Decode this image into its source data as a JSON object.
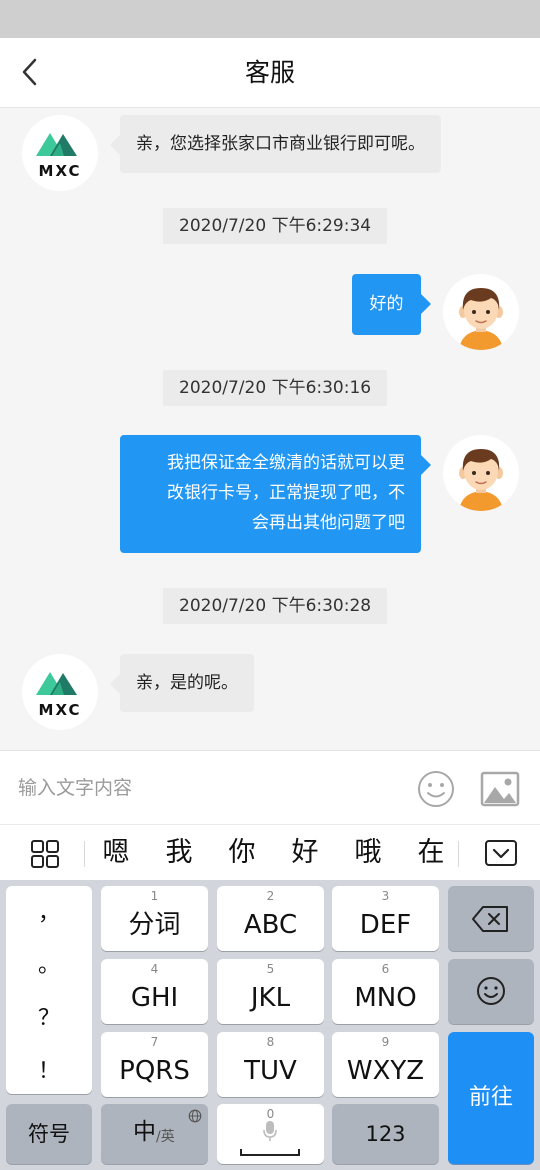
{
  "header": {
    "title": "客服"
  },
  "agent": {
    "logo_text": "MXC"
  },
  "messages": [
    {
      "side": "left",
      "text": "亲，您选择张家口市商业银行即可呢。"
    },
    {
      "timestamp": "2020/7/20 下午6:29:34"
    },
    {
      "side": "right",
      "text": "好的"
    },
    {
      "timestamp": "2020/7/20 下午6:30:16"
    },
    {
      "side": "right",
      "lines": [
        "我把保证金全缴清的话就可以更",
        "改银行卡号，正常提现了吧，不",
        "会再出其他问题了吧"
      ]
    },
    {
      "timestamp": "2020/7/20 下午6:30:28"
    },
    {
      "side": "left",
      "text": "亲，是的呢。"
    }
  ],
  "input": {
    "placeholder": "输入文字内容"
  },
  "candidates": [
    "嗯",
    "我",
    "你",
    "好",
    "哦",
    "在"
  ],
  "keyboard": {
    "punctuation": [
      "，",
      "。",
      "？",
      "！"
    ],
    "keys": [
      {
        "num": "1",
        "label": "分词"
      },
      {
        "num": "2",
        "label": "ABC"
      },
      {
        "num": "3",
        "label": "DEF"
      },
      {
        "num": "4",
        "label": "GHI"
      },
      {
        "num": "5",
        "label": "JKL"
      },
      {
        "num": "6",
        "label": "MNO"
      },
      {
        "num": "7",
        "label": "PQRS"
      },
      {
        "num": "8",
        "label": "TUV"
      },
      {
        "num": "9",
        "label": "WXYZ"
      }
    ],
    "symbols_label": "符号",
    "lang_main": "中",
    "lang_alt": "/英",
    "space_num": "0",
    "numbers_label": "123",
    "go_label": "前往"
  },
  "colors": {
    "accent": "#2196f3",
    "go_key": "#1e8ff5",
    "logo_green": "#3ec99a",
    "logo_dark": "#1f7a66"
  },
  "icons": [
    "back-icon",
    "mxc-logo",
    "user-avatar-icon",
    "emoji-icon",
    "image-icon",
    "grid-icon",
    "collapse-keyboard-icon",
    "backspace-icon",
    "smiley-key-icon",
    "globe-icon",
    "mic-icon"
  ]
}
